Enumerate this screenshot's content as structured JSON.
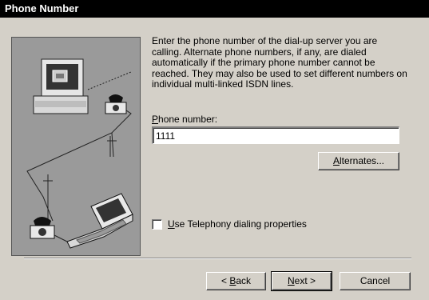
{
  "window": {
    "title": "Phone Number"
  },
  "description": "Enter the phone number of the dial-up server you are calling.  Alternate phone numbers, if any, are dialed automatically if the primary phone number cannot be reached.  They may also be used to set different numbers on individual multi-linked ISDN lines.",
  "phone": {
    "label_accel": "P",
    "label_rest": "hone number:",
    "value": "1111"
  },
  "alternates": {
    "accel": "A",
    "rest": "lternates..."
  },
  "telephony": {
    "accel": "U",
    "rest": "se Telephony dialing properties",
    "checked": false
  },
  "nav": {
    "back_prefix": "< ",
    "back_accel": "B",
    "back_rest": "ack",
    "next_accel": "N",
    "next_rest": "ext >",
    "cancel": "Cancel"
  },
  "icons": {
    "illustration": "dial-up-network-illustration",
    "checkbox": "checkbox-unchecked"
  }
}
